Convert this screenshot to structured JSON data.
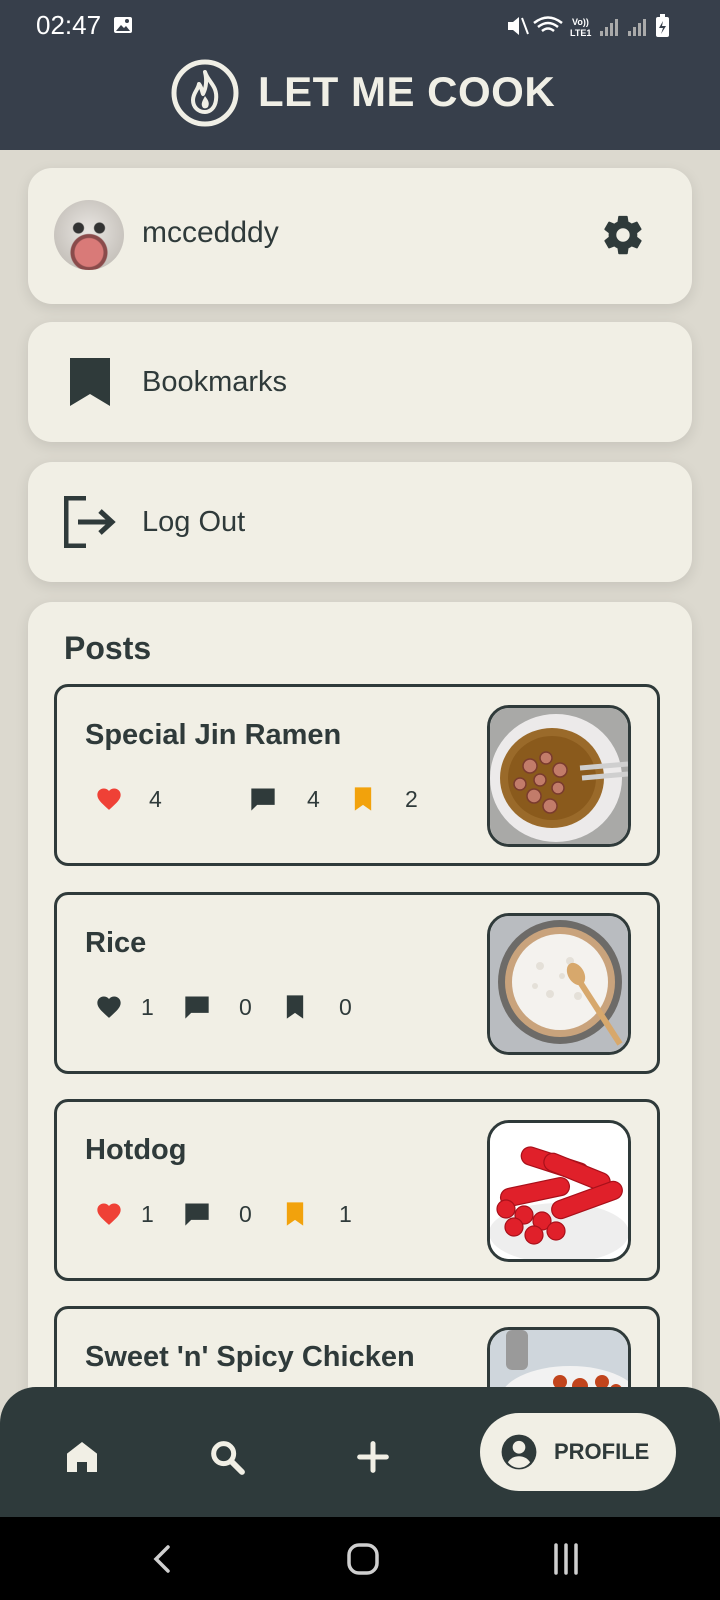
{
  "status_bar": {
    "time": "02:47",
    "network": "Vo)) LTE1"
  },
  "app": {
    "title": "LET ME COOK"
  },
  "profile_card": {
    "username": "mccedddy"
  },
  "menu": {
    "bookmarks_label": "Bookmarks",
    "logout_label": "Log Out"
  },
  "posts": {
    "heading": "Posts",
    "items": [
      {
        "title": "Special Jin Ramen",
        "likes": "4",
        "comments": "4",
        "bookmarks": "2",
        "liked": true,
        "bookmarked": true
      },
      {
        "title": "Rice",
        "likes": "1",
        "comments": "0",
        "bookmarks": "0",
        "liked": false,
        "bookmarked": false
      },
      {
        "title": "Hotdog",
        "likes": "1",
        "comments": "0",
        "bookmarks": "1",
        "liked": true,
        "bookmarked": true
      },
      {
        "title": "Sweet 'n' Spicy Chicken"
      }
    ]
  },
  "bottom_nav": {
    "items": [
      "home-icon",
      "search-icon",
      "add-icon",
      "account-circle-icon"
    ],
    "active_label": "PROFILE"
  },
  "colors": {
    "header_bg": "#373f4b",
    "card_bg": "#f1efe5",
    "text_dark": "#2f3a3a",
    "like_red": "#ef4136",
    "bookmark_orange": "#f2a20c",
    "nav_bg": "#2e3a3b"
  }
}
